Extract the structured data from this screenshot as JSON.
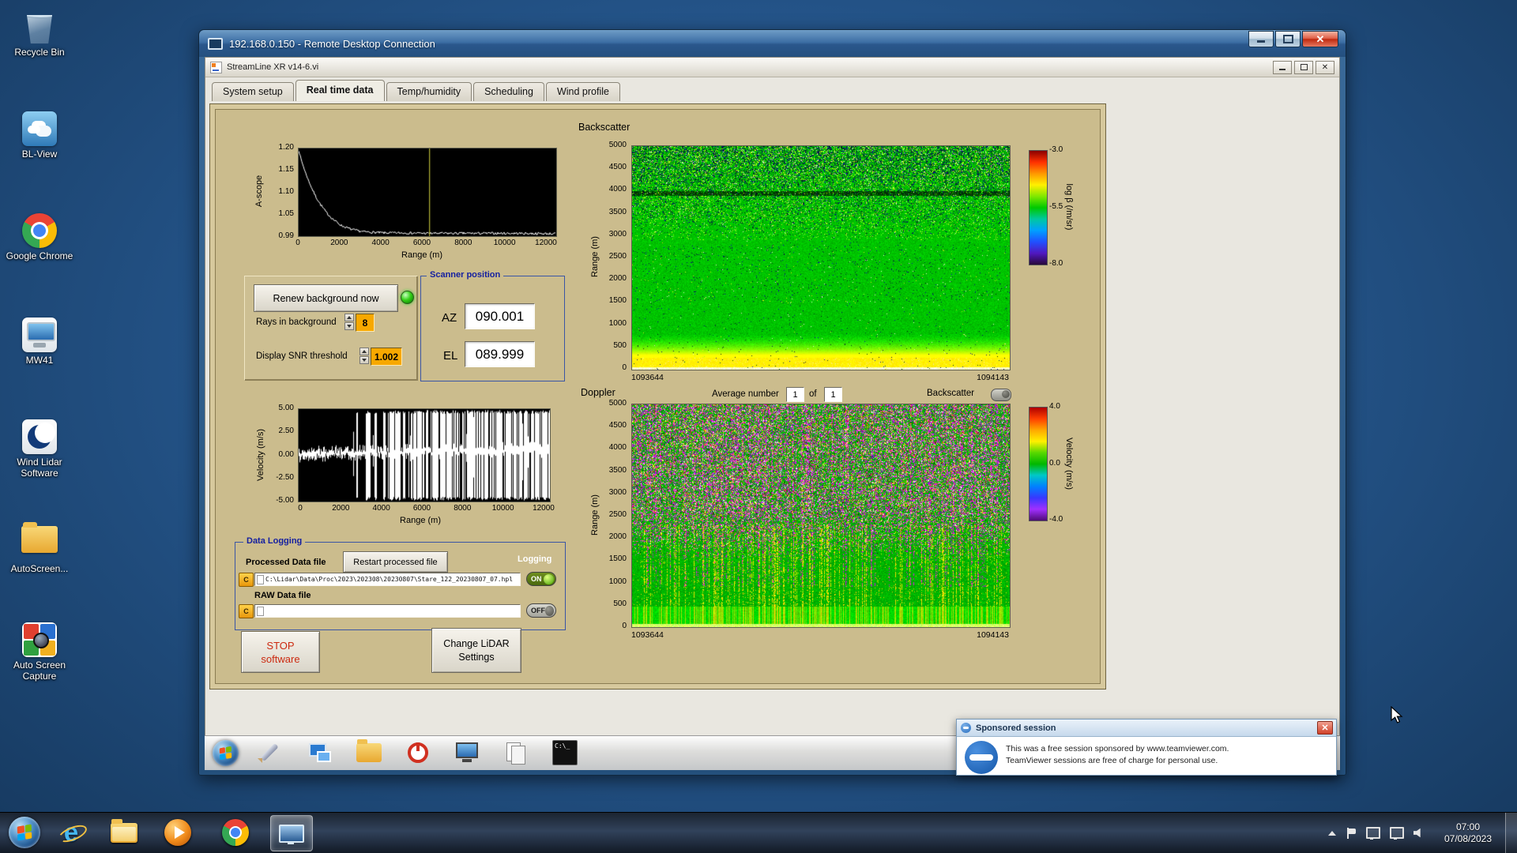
{
  "desktop": {
    "icons": [
      {
        "name": "recycle-bin",
        "label": "Recycle Bin"
      },
      {
        "name": "bl-view",
        "label": "BL-View"
      },
      {
        "name": "google-chrome",
        "label": "Google Chrome"
      },
      {
        "name": "mw41",
        "label": "MW41"
      },
      {
        "name": "wind-lidar-software",
        "label": "Wind Lidar Software"
      },
      {
        "name": "autoscreen-folder",
        "label": "AutoScreen..."
      },
      {
        "name": "auto-screen-capture",
        "label": "Auto Screen Capture"
      }
    ]
  },
  "rdp": {
    "title": "192.168.0.150 - Remote Desktop Connection"
  },
  "app": {
    "title": "StreamLine XR v14-6.vi",
    "tabs": [
      "System setup",
      "Real time data",
      "Temp/humidity",
      "Scheduling",
      "Wind profile"
    ],
    "active_tab": "Real time data"
  },
  "controls": {
    "renew_button": "Renew background now",
    "rays_label": "Rays in background",
    "rays_value": "8",
    "snr_label": "Display SNR threshold",
    "snr_value": "1.002",
    "scanner": {
      "title": "Scanner position",
      "az_label": "AZ",
      "az_value": "090.001",
      "el_label": "EL",
      "el_value": "089.999"
    },
    "doppler_header": {
      "average_label": "Average number",
      "average_value": "1",
      "of_label": "of",
      "total_value": "1",
      "toggle_label": "Backscatter"
    },
    "logging": {
      "title": "Data Logging",
      "processed_label": "Processed Data file",
      "restart_button": "Restart processed file",
      "logging_label": "Logging",
      "drive_letter": "C",
      "processed_path": "C:\\Lidar\\Data\\Proc\\2023\\202308\\20230807\\Stare_122_20230807_07.hpl",
      "processed_state": "ON",
      "raw_label": "RAW Data file",
      "raw_path": "",
      "raw_state": "OFF"
    },
    "stop_button_line1": "STOP",
    "stop_button_line2": "software",
    "settings_button_line1": "Change LiDAR",
    "settings_button_line2": "Settings"
  },
  "chart_data": [
    {
      "id": "a_scope",
      "type": "line",
      "title": "",
      "xlabel": "Range (m)",
      "ylabel": "A-scope",
      "xlim": [
        0,
        12000
      ],
      "ylim": [
        0.99,
        1.2
      ],
      "xticks": [
        "0",
        "2000",
        "4000",
        "6000",
        "8000",
        "10000",
        "12000"
      ],
      "yticks": [
        "1.20",
        "1.15",
        "1.10",
        "1.05",
        "0.99"
      ],
      "cursor_x": 6100,
      "x": [
        0,
        150,
        300,
        450,
        600,
        800,
        1000,
        1300,
        1600,
        2000,
        2500,
        3000,
        4000,
        5000,
        6000,
        8000,
        10000,
        12000
      ],
      "y": [
        1.2,
        1.172,
        1.148,
        1.127,
        1.108,
        1.086,
        1.068,
        1.046,
        1.03,
        1.014,
        1.004,
        0.999,
        0.996,
        0.996,
        0.995,
        0.995,
        0.995,
        0.994
      ],
      "line_color": "#ffffff",
      "bg": "#000000",
      "grid": false
    },
    {
      "id": "backscatter",
      "type": "heatmap",
      "title": "Backscatter",
      "ylabel": "Range (m)",
      "ylim": [
        0,
        5000
      ],
      "yticks": [
        "5000",
        "4500",
        "4000",
        "3500",
        "3000",
        "2500",
        "2000",
        "1500",
        "1000",
        "500",
        "0"
      ],
      "x_start_label": "1093644",
      "x_end_label": "1094143",
      "colorbar": {
        "label": "log β (/m/sr)",
        "ticks": [
          "-3.0",
          "-5.5",
          "-8.0"
        ],
        "min": -8.0,
        "max": -3.0,
        "stops": [
          "#8a0000",
          "#ff3000",
          "#ff9800",
          "#fff000",
          "#80e800",
          "#00c800",
          "#00c8a0",
          "#00a0ff",
          "#2050ff",
          "#5018c0",
          "#28083a"
        ]
      },
      "features": {
        "surface_band_top_m": 500,
        "noise_floor_start_m": 2800,
        "dark_layer_m": 3950,
        "description": "uniform green aerosol return (~-5.3) with bright yellow surface band below 500 m, speckle noise increasing above 2800 m, dark layer near 3950 m"
      }
    },
    {
      "id": "doppler",
      "type": "heatmap",
      "title": "Doppler",
      "ylabel": "Range (m)",
      "ylim": [
        0,
        5000
      ],
      "yticks": [
        "5000",
        "4500",
        "4000",
        "3500",
        "3000",
        "2500",
        "2000",
        "1500",
        "1000",
        "500",
        "0"
      ],
      "x_start_label": "1093644",
      "x_end_label": "1094143",
      "colorbar": {
        "label": "Velocity (m/s)",
        "ticks": [
          "4.0",
          "0.0",
          "-4.0"
        ],
        "min": -4.0,
        "max": 4.0,
        "stops": [
          "#b00000",
          "#ff4000",
          "#ffa800",
          "#fff000",
          "#58d800",
          "#00b800",
          "#00c8c8",
          "#0080ff",
          "#3838ff",
          "#a030ff",
          "#500a78"
        ]
      },
      "features": {
        "clean_top_m": 2300,
        "description": "green near-zero velocities below ~2000 m with yellow and magenta vertical streaks; saturated magenta/white/yellow noise above ~2500 m"
      }
    },
    {
      "id": "velocity",
      "type": "line",
      "title": "",
      "xlabel": "Range (m)",
      "ylabel": "Velocity (m/s)",
      "xlim": [
        0,
        12000
      ],
      "ylim": [
        -5,
        5
      ],
      "xticks": [
        "0",
        "2000",
        "4000",
        "6000",
        "8000",
        "10000",
        "12000"
      ],
      "yticks": [
        "5.00",
        "2.50",
        "0.00",
        "-2.50",
        "-5.00"
      ],
      "baseline": [
        [
          0,
          0.1
        ],
        [
          3000,
          0.3
        ],
        [
          12000,
          0.7
        ]
      ],
      "noise": "low-amplitude noise below ~2500 m, dense full-scale ±5 m/s spikes from ~2800 m to 12000 m",
      "line_color": "#ffffff",
      "bg": "#000000",
      "grid": false
    }
  ],
  "teamviewer": {
    "title": "Sponsored session",
    "line1": "This was a free session sponsored by www.teamviewer.com.",
    "line2": "TeamViewer sessions are free of charge for personal use."
  },
  "taskbar": {
    "time": "07:00",
    "date": "07/08/2023",
    "cmd_icon_text": "C:\\_"
  }
}
